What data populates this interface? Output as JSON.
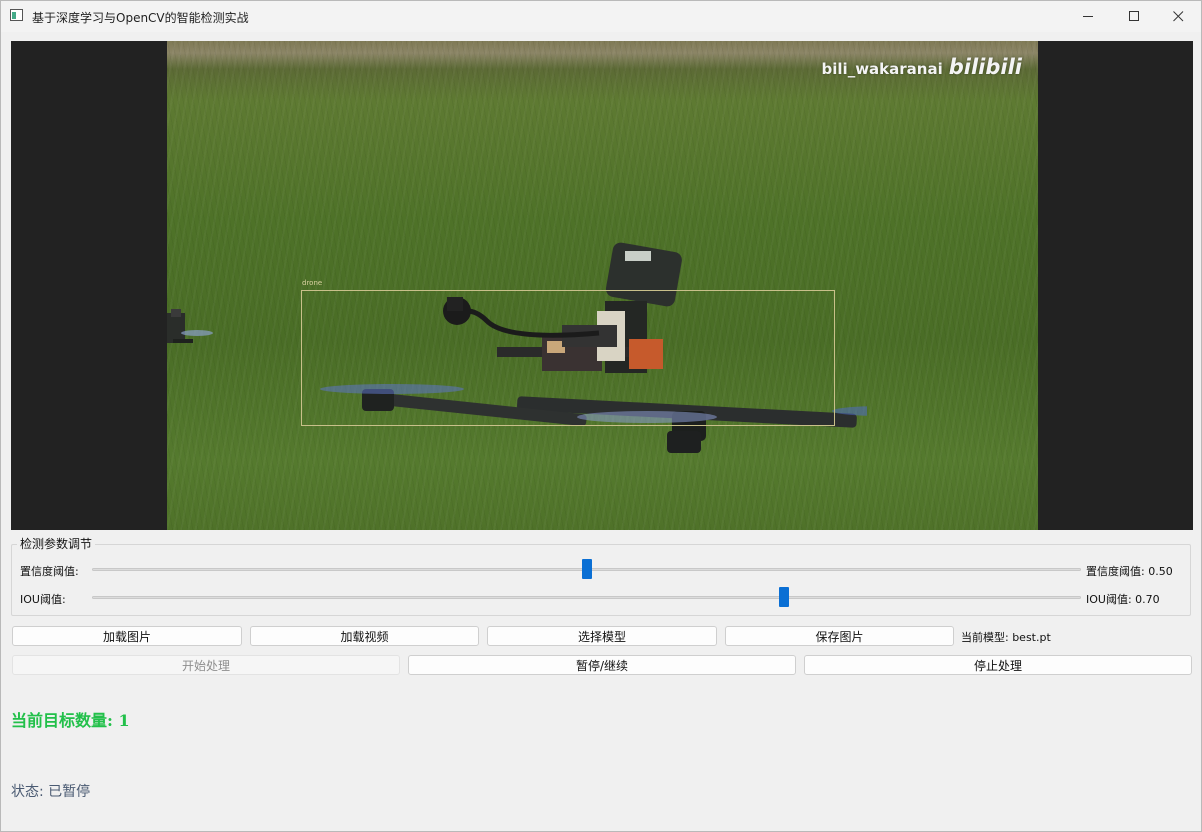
{
  "window": {
    "title": "基于深度学习与OpenCV的智能检测实战"
  },
  "video": {
    "watermark_text": "bili_wakaranai",
    "watermark_logo": "bilibili",
    "detection_label": "drone"
  },
  "params": {
    "group_title": "检测参数调节",
    "confidence": {
      "label": "置信度阈值:",
      "value_text": "置信度阈值: 0.50",
      "value": 0.5
    },
    "iou": {
      "label": "IOU阈值:",
      "value_text": "IOU阈值: 0.70",
      "value": 0.7
    }
  },
  "buttons": {
    "load_image": "加载图片",
    "load_video": "加载视频",
    "select_model": "选择模型",
    "save_image": "保存图片",
    "start": "开始处理",
    "pause_resume": "暂停/继续",
    "stop": "停止处理"
  },
  "current_model": "当前模型: best.pt",
  "target_count": "当前目标数量: 1",
  "status": "状态: 已暂停",
  "colors": {
    "slider_handle": "#0a6fd4",
    "count_text": "#22c04a",
    "status_text": "#4a5a72",
    "video_background": "#222222"
  }
}
